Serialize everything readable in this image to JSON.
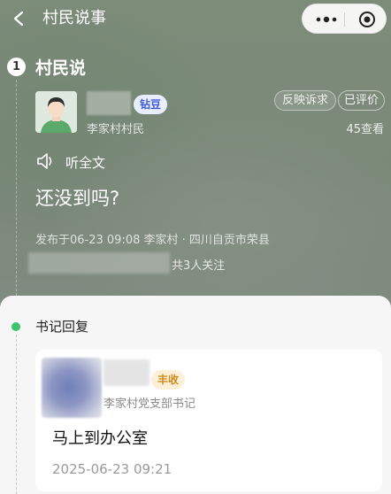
{
  "nav": {
    "title": "村民说事",
    "back_icon": "chevron-left-icon",
    "more_icon": "more-dots-icon",
    "close_icon": "target-close-icon"
  },
  "post": {
    "step_number": "1",
    "section_title": "村民说",
    "author_badge": "钻豆",
    "author_role": "李家村村民",
    "tag_feedback": "反映诉求",
    "tag_evaluated": "已评价",
    "views": "45查看",
    "listen_label": "听全文",
    "content": "还没到吗?",
    "meta": "发布于06-23 09:08   李家村 · 四川自贡市荣县",
    "followers": "共3人关注"
  },
  "reply": {
    "section_title": "书记回复",
    "badge": "丰收",
    "replier_role": "李家村党支部书记",
    "content": "马上到办公室",
    "time": "2025-06-23 09:21"
  },
  "colors": {
    "accent_green": "#3cc46a",
    "badge_blue": "#3d5bd9",
    "badge_orange": "#d08a1c"
  }
}
